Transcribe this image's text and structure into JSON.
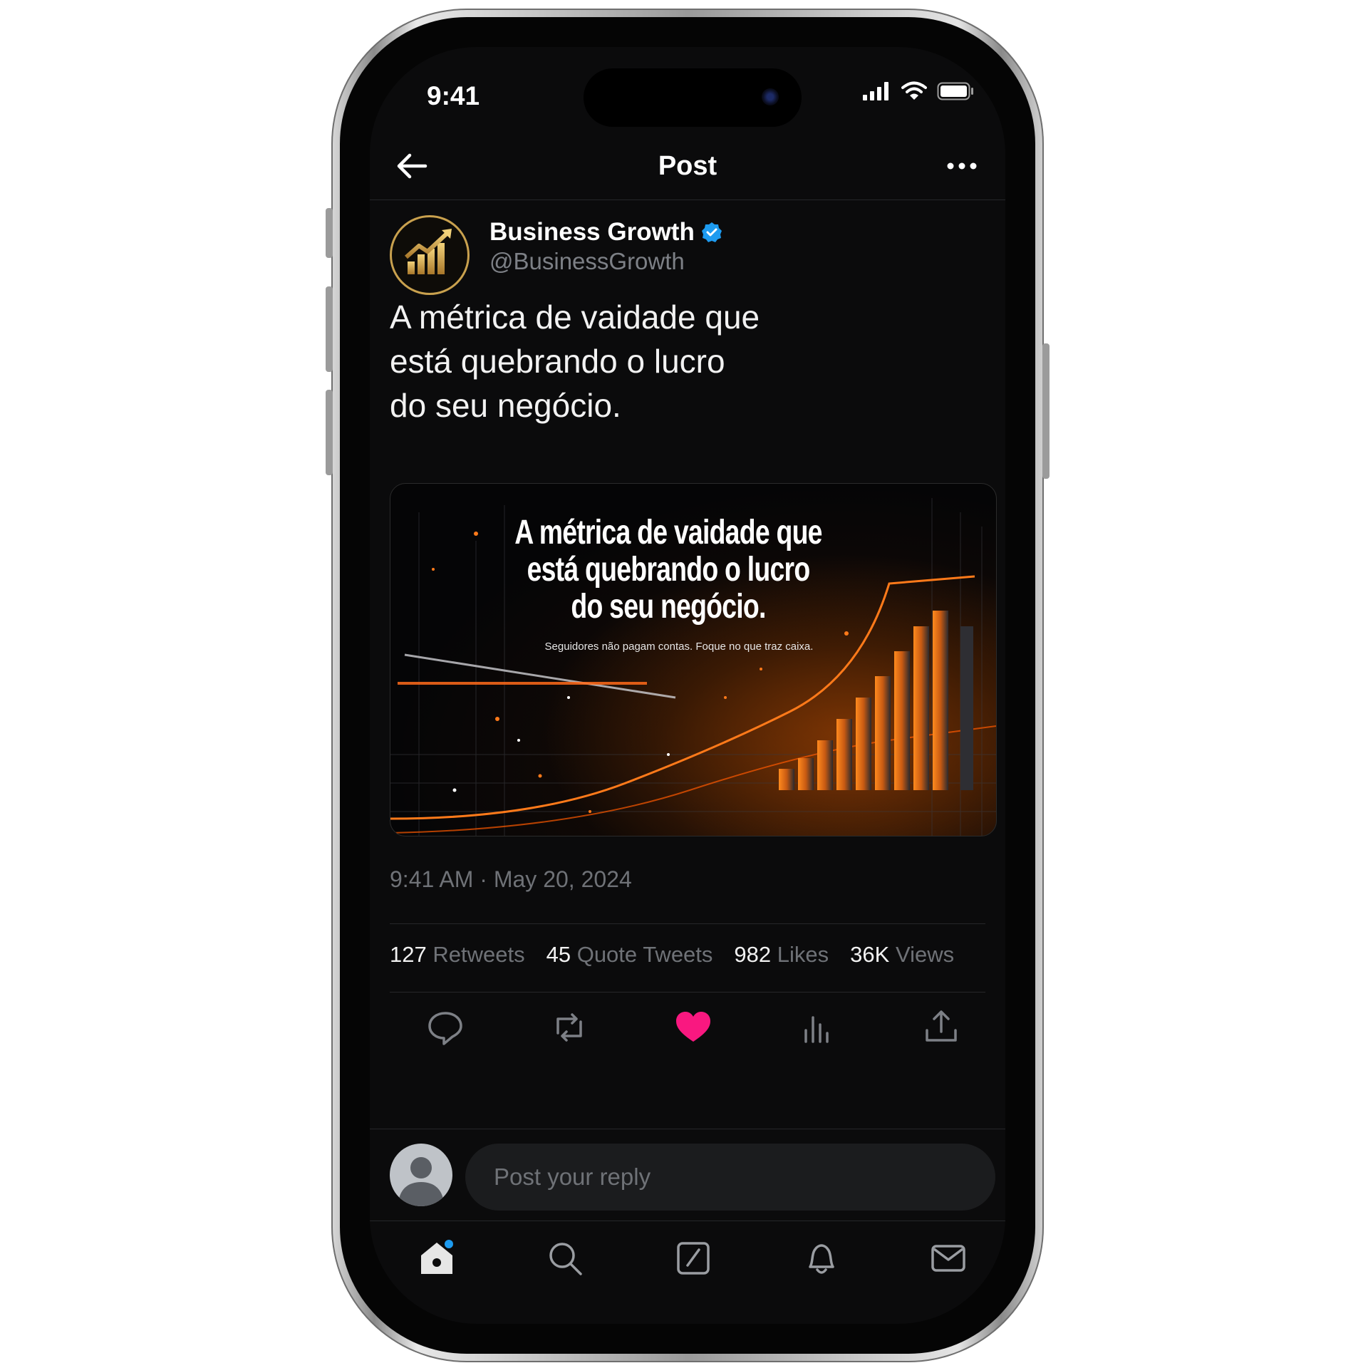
{
  "status_bar": {
    "time": "9:41"
  },
  "nav": {
    "title": "Post"
  },
  "author": {
    "name": "Business Growth",
    "handle": "@BusinessGrowth",
    "verified": true
  },
  "post": {
    "text_lines": [
      "A métrica de vaidade que",
      "está quebrando o lucro",
      "do seu negócio."
    ],
    "timestamp": "9:41 AM · May 20, 2024"
  },
  "media": {
    "headline_lines": [
      "A métrica de vaidade que",
      "está quebrando o lucro",
      "do seu negócio."
    ],
    "subtitle": "Seguidores não pagam contas. Foque no que traz caixa."
  },
  "stats": [
    {
      "num": "127",
      "label": "Retweets"
    },
    {
      "num": "45",
      "label": "Quote Tweets"
    },
    {
      "num": "982",
      "label": "Likes"
    },
    {
      "num": "36K",
      "label": "Views"
    }
  ],
  "actions": [
    {
      "name": "reply",
      "icon": "comment-icon"
    },
    {
      "name": "retweet",
      "icon": "retweet-icon"
    },
    {
      "name": "like",
      "icon": "heart-icon",
      "active": true
    },
    {
      "name": "views",
      "icon": "analytics-icon"
    },
    {
      "name": "share",
      "icon": "share-icon"
    }
  ],
  "reply": {
    "placeholder": "Post your reply"
  },
  "tabs": [
    {
      "name": "home",
      "icon": "home-icon",
      "has_notification_dot": true
    },
    {
      "name": "search",
      "icon": "search-icon"
    },
    {
      "name": "compose",
      "icon": "compose-icon"
    },
    {
      "name": "notifications",
      "icon": "bell-icon"
    },
    {
      "name": "messages",
      "icon": "mail-icon"
    }
  ],
  "colors": {
    "background": "#0b0b0c",
    "like_active": "#f91880",
    "verified": "#1d9bf0",
    "notification_dot": "#1d9bf0",
    "muted_text": "#6f7277",
    "avatar_ring": "#c9a14e"
  }
}
